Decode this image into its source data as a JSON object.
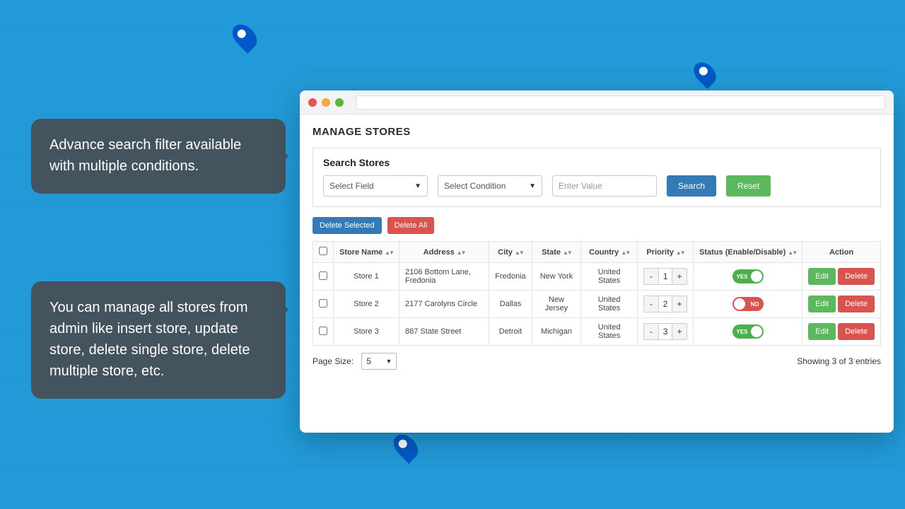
{
  "callouts": {
    "c1": "Advance search filter available with multiple conditions.",
    "c2": "You can manage all stores from admin like insert store, update store, delete single store, delete multiple store, etc."
  },
  "page": {
    "title": "MANAGE STORES"
  },
  "search": {
    "heading": "Search Stores",
    "field_placeholder": "Select Field",
    "condition_placeholder": "Select Condition",
    "value_placeholder": "Enter Value",
    "search_btn": "Search",
    "reset_btn": "Reset"
  },
  "bulk": {
    "delete_selected": "Delete Selected",
    "delete_all": "Delete All"
  },
  "table": {
    "headers": {
      "store_name": "Store Name",
      "address": "Address",
      "city": "City",
      "state": "State",
      "country": "Country",
      "priority": "Priority",
      "status": "Status (Enable/Disable)",
      "action": "Action"
    },
    "rows": [
      {
        "name": "Store 1",
        "address": "2106 Bottom Lane, Fredonia",
        "city": "Fredonia",
        "state": "New York",
        "country": "United States",
        "priority": "1",
        "status": "on",
        "status_label": "YES"
      },
      {
        "name": "Store 2",
        "address": "2177 Carolyns Circle",
        "city": "Dallas",
        "state": "New Jersey",
        "country": "United States",
        "priority": "2",
        "status": "off",
        "status_label": "NO"
      },
      {
        "name": "Store 3",
        "address": "887 State Street",
        "city": "Detroit",
        "state": "Michigan",
        "country": "United States",
        "priority": "3",
        "status": "on",
        "status_label": "YES"
      }
    ],
    "edit_label": "Edit",
    "delete_label": "Delete"
  },
  "footer": {
    "page_size_label": "Page Size:",
    "page_size_value": "5",
    "entries_text": "Showing 3 of 3 entries"
  }
}
